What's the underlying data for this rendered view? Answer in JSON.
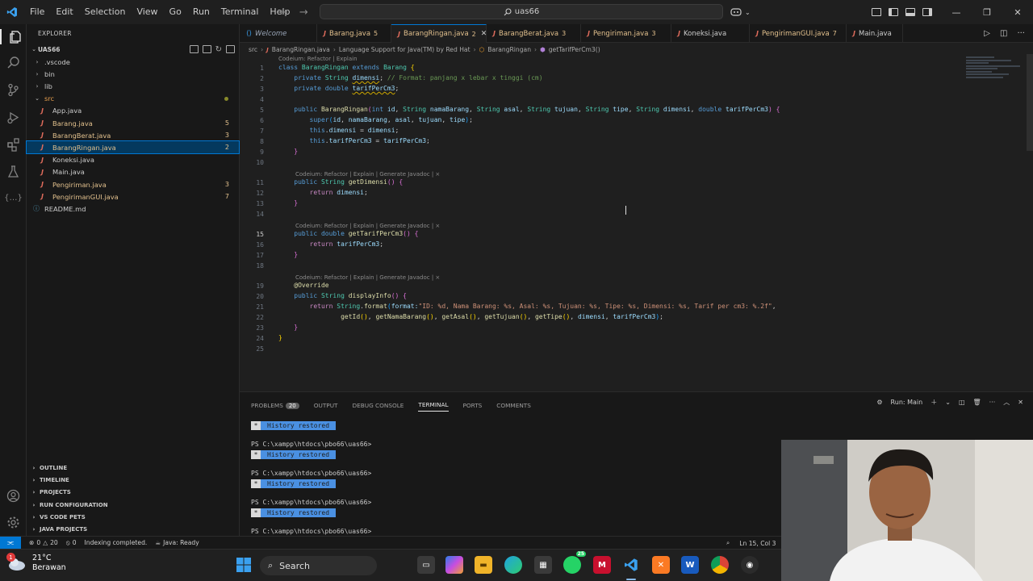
{
  "menu": [
    "File",
    "Edit",
    "Selection",
    "View",
    "Go",
    "Run",
    "Terminal",
    "Help"
  ],
  "search": {
    "value": "uas66"
  },
  "explorer": {
    "title": "EXPLORER",
    "project": "UAS66",
    "tree": [
      {
        "label": ".vscode",
        "type": "folder",
        "depth": 1,
        "open": false
      },
      {
        "label": "bin",
        "type": "folder",
        "depth": 1,
        "open": false
      },
      {
        "label": "lib",
        "type": "folder",
        "depth": 1,
        "open": false
      },
      {
        "label": "src",
        "type": "folder",
        "depth": 1,
        "open": true,
        "dot": true,
        "color": "#e8a04f"
      },
      {
        "label": "App.java",
        "type": "java",
        "depth": 2
      },
      {
        "label": "Barang.java",
        "type": "java",
        "depth": 2,
        "badge": "5",
        "color": "#e2c08d"
      },
      {
        "label": "BarangBerat.java",
        "type": "java",
        "depth": 2,
        "badge": "3",
        "color": "#e2c08d"
      },
      {
        "label": "BarangRingan.java",
        "type": "java",
        "depth": 2,
        "badge": "2",
        "color": "#e2c08d",
        "selected": true
      },
      {
        "label": "Koneksi.java",
        "type": "java",
        "depth": 2
      },
      {
        "label": "Main.java",
        "type": "java",
        "depth": 2
      },
      {
        "label": "Pengiriman.java",
        "type": "java",
        "depth": 2,
        "badge": "3",
        "color": "#e2c08d"
      },
      {
        "label": "PengirimanGUI.java",
        "type": "java",
        "depth": 2,
        "badge": "7",
        "color": "#e2c08d"
      },
      {
        "label": "README.md",
        "type": "md",
        "depth": 1
      }
    ],
    "sections": [
      "OUTLINE",
      "TIMELINE",
      "PROJECTS",
      "RUN CONFIGURATION",
      "VS CODE PETS",
      "JAVA PROJECTS"
    ]
  },
  "tabs": [
    {
      "label": "Welcome",
      "kind": "welcome"
    },
    {
      "label": "Barang.java",
      "badge": "5",
      "kind": "java"
    },
    {
      "label": "BarangRingan.java",
      "badge": "2",
      "kind": "java",
      "active": true
    },
    {
      "label": "BarangBerat.java",
      "badge": "3",
      "kind": "java"
    },
    {
      "label": "Pengiriman.java",
      "badge": "3",
      "kind": "java"
    },
    {
      "label": "Koneksi.java",
      "badge": "",
      "kind": "java"
    },
    {
      "label": "PengirimanGUI.java",
      "badge": "7",
      "kind": "java"
    },
    {
      "label": "Main.java",
      "badge": "",
      "kind": "java"
    }
  ],
  "breadcrumb": [
    "src",
    "BarangRingan.java",
    "Language Support for Java(TM) by Red Hat",
    "BarangRingan",
    "getTarifPerCm3()"
  ],
  "codelens": {
    "first": "Codeium: Refactor | Explain",
    "method": "Codeium: Refactor | Explain | Generate Javadoc | ×"
  },
  "code": {
    "current_line": 15,
    "lines": [
      [
        [
          "kw",
          "class "
        ],
        [
          "ty",
          "BarangRingan "
        ],
        [
          "kw",
          "extends "
        ],
        [
          "ty",
          "Barang "
        ],
        [
          "br1",
          "{"
        ]
      ],
      [
        [
          "",
          "    "
        ],
        [
          "kw",
          "private "
        ],
        [
          "ty",
          "String "
        ],
        [
          "va",
          "dimensi",
          "squig"
        ],
        [
          "",
          ";"
        ],
        [
          "cm",
          " // Format: panjang x lebar x tinggi (cm)"
        ]
      ],
      [
        [
          "",
          "    "
        ],
        [
          "kw",
          "private "
        ],
        [
          "kw",
          "double "
        ],
        [
          "va",
          "tarifPerCm3",
          "squig"
        ],
        [
          "",
          ";"
        ]
      ],
      [],
      [
        [
          "",
          "    "
        ],
        [
          "kw",
          "public "
        ],
        [
          "fn",
          "BarangRingan"
        ],
        [
          "br2",
          "("
        ],
        [
          "kw",
          "int "
        ],
        [
          "va",
          "id"
        ],
        [
          "",
          ", "
        ],
        [
          "ty",
          "String "
        ],
        [
          "va",
          "namaBarang"
        ],
        [
          "",
          ", "
        ],
        [
          "ty",
          "String "
        ],
        [
          "va",
          "asal"
        ],
        [
          "",
          ", "
        ],
        [
          "ty",
          "String "
        ],
        [
          "va",
          "tujuan"
        ],
        [
          "",
          ", "
        ],
        [
          "ty",
          "String "
        ],
        [
          "va",
          "tipe"
        ],
        [
          "",
          ", "
        ],
        [
          "ty",
          "String "
        ],
        [
          "va",
          "dimensi"
        ],
        [
          "",
          ", "
        ],
        [
          "kw",
          "double "
        ],
        [
          "va",
          "tarifPerCm3"
        ],
        [
          "br2",
          ")"
        ],
        [
          "br2",
          " {"
        ]
      ],
      [
        [
          "",
          "        "
        ],
        [
          "kw",
          "super"
        ],
        [
          "br3",
          "("
        ],
        [
          "va",
          "id"
        ],
        [
          "",
          ", "
        ],
        [
          "va",
          "namaBarang"
        ],
        [
          "",
          ", "
        ],
        [
          "va",
          "asal"
        ],
        [
          "",
          ", "
        ],
        [
          "va",
          "tujuan"
        ],
        [
          "",
          ", "
        ],
        [
          "va",
          "tipe"
        ],
        [
          "br3",
          ")"
        ],
        [
          "",
          ";"
        ]
      ],
      [
        [
          "",
          "        "
        ],
        [
          "kw",
          "this"
        ],
        [
          "",
          "."
        ],
        [
          "va",
          "dimensi"
        ],
        [
          "",
          " = "
        ],
        [
          "va",
          "dimensi"
        ],
        [
          "",
          ";"
        ]
      ],
      [
        [
          "",
          "        "
        ],
        [
          "kw",
          "this"
        ],
        [
          "",
          "."
        ],
        [
          "va",
          "tarifPerCm3"
        ],
        [
          "",
          " = "
        ],
        [
          "va",
          "tarifPerCm3"
        ],
        [
          "",
          ";"
        ]
      ],
      [
        [
          "",
          "    "
        ],
        [
          "br2",
          "}"
        ]
      ],
      [],
      [
        [
          "",
          "    "
        ],
        [
          "kw",
          "public "
        ],
        [
          "ty",
          "String "
        ],
        [
          "fn",
          "getDimensi"
        ],
        [
          "br2",
          "() {"
        ]
      ],
      [
        [
          "",
          "        "
        ],
        [
          "ctl",
          "return "
        ],
        [
          "va",
          "dimensi"
        ],
        [
          "",
          ";"
        ]
      ],
      [
        [
          "",
          "    "
        ],
        [
          "br2",
          "}"
        ]
      ],
      [],
      [
        [
          "",
          "    "
        ],
        [
          "kw",
          "public "
        ],
        [
          "kw",
          "double "
        ],
        [
          "fn",
          "getTarifPerCm3"
        ],
        [
          "br2",
          "() {"
        ]
      ],
      [
        [
          "",
          "        "
        ],
        [
          "ctl",
          "return "
        ],
        [
          "va",
          "tarifPerCm3"
        ],
        [
          "",
          ";"
        ]
      ],
      [
        [
          "",
          "    "
        ],
        [
          "br2",
          "}"
        ]
      ],
      [],
      [
        [
          "",
          "    "
        ],
        [
          "ann",
          "@Override"
        ]
      ],
      [
        [
          "",
          "    "
        ],
        [
          "kw",
          "public "
        ],
        [
          "ty",
          "String "
        ],
        [
          "fn",
          "displayInfo"
        ],
        [
          "br2",
          "() {"
        ]
      ],
      [
        [
          "",
          "        "
        ],
        [
          "ctl",
          "return "
        ],
        [
          "ty",
          "String"
        ],
        [
          "",
          "."
        ],
        [
          "fn",
          "format"
        ],
        [
          "br3",
          "("
        ],
        [
          "va",
          "format:"
        ],
        [
          "str",
          "\"ID: %d, Nama Barang: %s, Asal: %s, Tujuan: %s, Tipe: %s, Dimensi: %s, Tarif per cm3: %.2f\""
        ],
        [
          "",
          ","
        ]
      ],
      [
        [
          "",
          "                "
        ],
        [
          "fn",
          "getId"
        ],
        [
          "br1",
          "()"
        ],
        [
          "",
          ", "
        ],
        [
          "fn",
          "getNamaBarang"
        ],
        [
          "br1",
          "()"
        ],
        [
          "",
          ", "
        ],
        [
          "fn",
          "getAsal"
        ],
        [
          "br1",
          "()"
        ],
        [
          "",
          ", "
        ],
        [
          "fn",
          "getTujuan"
        ],
        [
          "br1",
          "()"
        ],
        [
          "",
          ", "
        ],
        [
          "fn",
          "getTipe"
        ],
        [
          "br1",
          "()"
        ],
        [
          "",
          ", "
        ],
        [
          "va",
          "dimensi"
        ],
        [
          "",
          ", "
        ],
        [
          "va",
          "tarifPerCm3"
        ],
        [
          "br3",
          ")"
        ],
        [
          "",
          ";"
        ]
      ],
      [
        [
          "",
          "    "
        ],
        [
          "br2",
          "}"
        ]
      ],
      [
        [
          "br1",
          "}"
        ]
      ],
      []
    ]
  },
  "panel": {
    "tabs": [
      {
        "label": "PROBLEMS",
        "badge": "20"
      },
      {
        "label": "OUTPUT"
      },
      {
        "label": "DEBUG CONSOLE"
      },
      {
        "label": "TERMINAL",
        "active": true
      },
      {
        "label": "PORTS"
      },
      {
        "label": "COMMENTS"
      }
    ],
    "run_label": "Run: Main",
    "terminal": {
      "history_label": "History restored",
      "prompt": "PS C:\\xampp\\htdocs\\pbo66\\uas66>"
    }
  },
  "statusbar": {
    "errors": "0",
    "warnings": "20",
    "ports": "0",
    "indexing": "Indexing completed.",
    "java": "Java: Ready",
    "position": "Ln 15, Col 3"
  },
  "taskbar": {
    "temperature": "21°C",
    "weather": "Berawan",
    "notif_count": "1",
    "search_label": "Search",
    "whatsapp_badge": "25"
  },
  "colors": {
    "accent": "#0078d4",
    "java_icon": "#e06c5c",
    "modified": "#e2c08d"
  }
}
